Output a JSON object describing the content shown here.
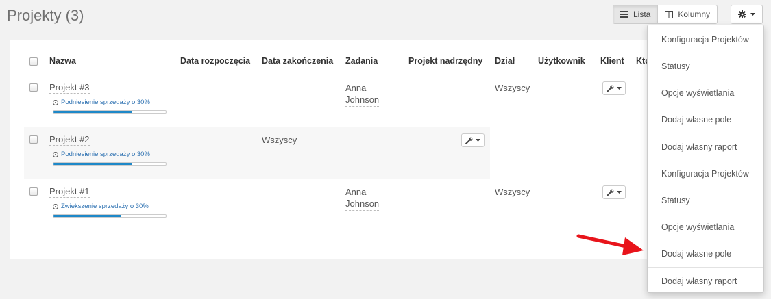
{
  "header": {
    "title": "Projekty (3)"
  },
  "view_toggle": {
    "list_label": "Lista",
    "columns_label": "Kolumny"
  },
  "table": {
    "columns": [
      "Nazwa",
      "Data rozpoczęcia",
      "Data zakończenia",
      "Zadania",
      "Projekt nadrzędny",
      "Dział",
      "Użytkownik",
      "Klient",
      "Kto"
    ],
    "rows": [
      {
        "name": "Projekt #3",
        "goal": "Podniesienie sprzedaży o 30%",
        "progress": 0.7,
        "start": "",
        "end": "",
        "tasks": [
          "Anna",
          "Johnson"
        ],
        "parent": "",
        "department": "Wszyscy",
        "user": "",
        "client": ""
      },
      {
        "name": "Projekt #2",
        "goal": "Podniesienie sprzedaży o 30%",
        "progress": 0.7,
        "start": "",
        "end": "Wszyscy",
        "tasks": [
          "",
          ""
        ],
        "parent": "",
        "department": "",
        "user": "",
        "client": ""
      },
      {
        "name": "Projekt #1",
        "goal": "Zwiększenie sprzedaży o 30%",
        "progress": 0.6,
        "start": "",
        "end": "",
        "tasks": [
          "Anna",
          "Johnson"
        ],
        "parent": "",
        "department": "Wszyscy",
        "user": "",
        "client": ""
      }
    ]
  },
  "settings_menu": {
    "items": [
      "Konfiguracja Projektów",
      "Statusy",
      "Opcje wyświetlania",
      "Dodaj własne pole",
      "Dodaj własny raport",
      "Konfiguracja Projektów",
      "Statusy",
      "Opcje wyświetlania",
      "Dodaj własne pole",
      "Dodaj własny raport"
    ]
  },
  "icons": {
    "list": "list-icon",
    "columns": "columns-icon",
    "gear": "gear-icon",
    "wrench": "wrench-icon",
    "caret": "caret-down-icon",
    "goal": "target-icon",
    "arrow": "red-arrow-icon"
  },
  "colors": {
    "progress": "#1e88c8",
    "arrow": "#e8141b",
    "goal_link": "#2a6fb0"
  }
}
